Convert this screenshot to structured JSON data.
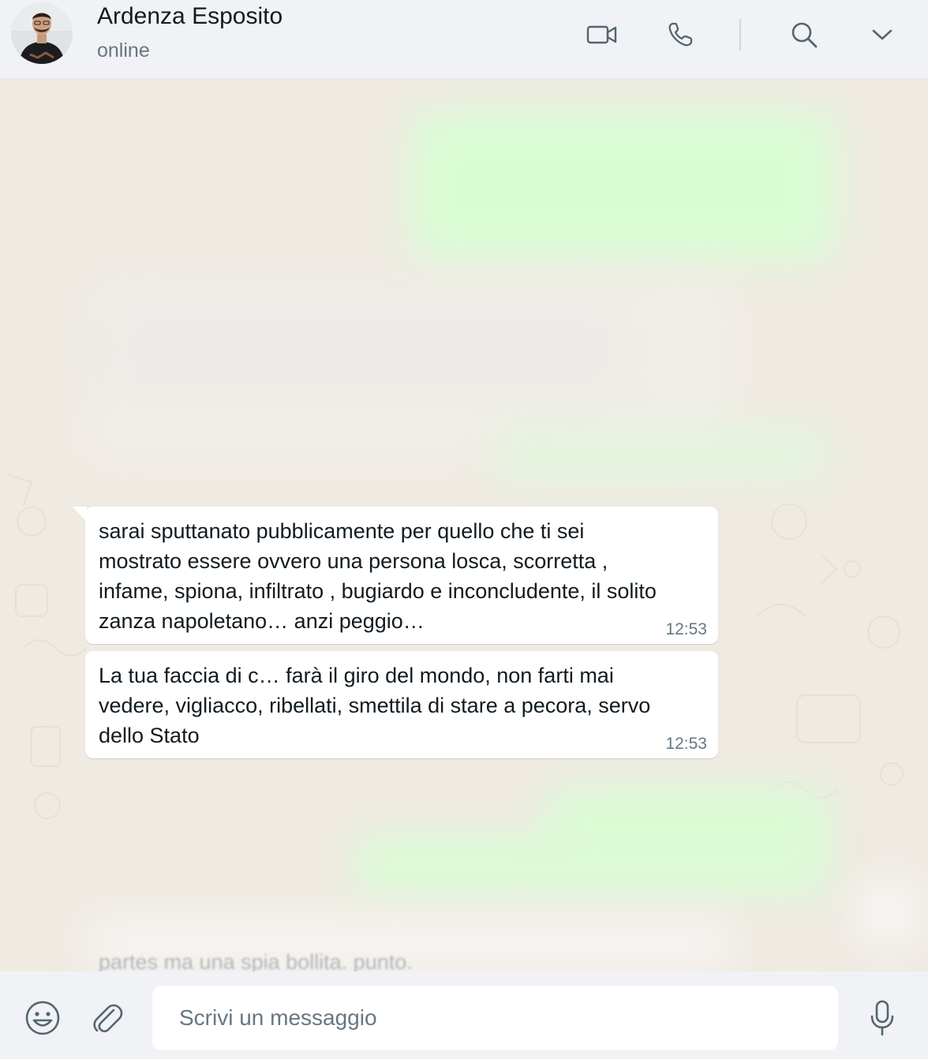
{
  "header": {
    "contact_name": "Ardenza Esposito",
    "status": "online",
    "icons": [
      "video-call-icon",
      "voice-call-icon",
      "search-icon",
      "chevron-down-icon"
    ]
  },
  "messages": [
    {
      "direction": "incoming",
      "text": "sarai sputtanato pubblicamente per quello che ti sei\nmostrato essere ovvero una persona losca, scorretta ,\ninfame, spiona, infiltrato , bugiardo e inconcludente, il solito\nzanza napoletano… anzi peggio…",
      "time": "12:53"
    },
    {
      "direction": "incoming",
      "text": "La tua faccia di c… farà il giro del mondo, non farti mai\nvedere, vigliacco, ribellati, smettila di stare a pecora, servo\ndello Stato",
      "time": "12:53"
    }
  ],
  "partial_message": "partes ma una spia bollita. punto.",
  "composer": {
    "placeholder": "Scrivi un messaggio",
    "value": ""
  },
  "colors": {
    "chat_background": "#efeae2",
    "incoming_bubble": "#ffffff",
    "outgoing_bubble": "#d9fdd3",
    "header_background": "#f0f2f5",
    "icon_color": "#54656f"
  }
}
